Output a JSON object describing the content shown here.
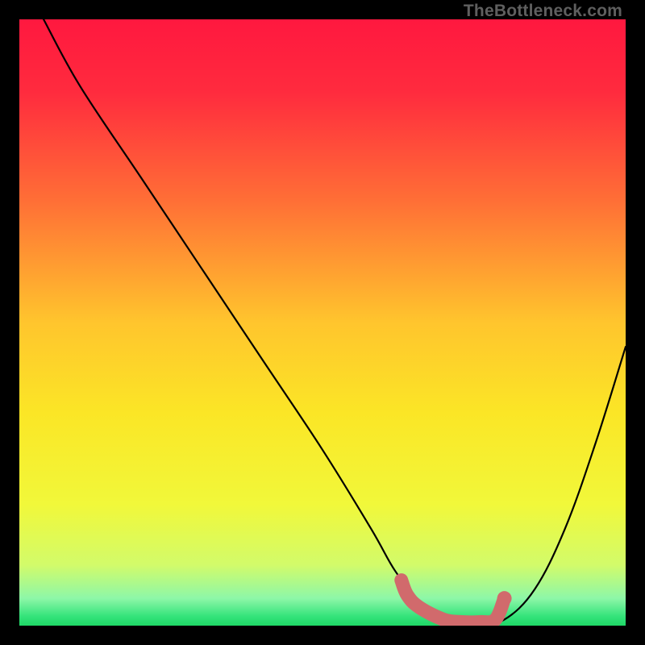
{
  "watermark": "TheBottleneck.com",
  "chart_data": {
    "type": "line",
    "title": "",
    "xlabel": "",
    "ylabel": "",
    "xlim": [
      0,
      100
    ],
    "ylim": [
      0,
      100
    ],
    "gradient_stops": [
      {
        "pos": 0.0,
        "color": "#ff183f"
      },
      {
        "pos": 0.12,
        "color": "#ff2b3e"
      },
      {
        "pos": 0.3,
        "color": "#ff6f36"
      },
      {
        "pos": 0.5,
        "color": "#ffc52d"
      },
      {
        "pos": 0.65,
        "color": "#fbe626"
      },
      {
        "pos": 0.8,
        "color": "#f1f83a"
      },
      {
        "pos": 0.9,
        "color": "#d2fb6a"
      },
      {
        "pos": 0.955,
        "color": "#8df7a8"
      },
      {
        "pos": 0.985,
        "color": "#33e37a"
      },
      {
        "pos": 1.0,
        "color": "#1fd866"
      }
    ],
    "series": [
      {
        "name": "bottleneck-curve",
        "x": [
          4,
          10,
          20,
          30,
          40,
          50,
          58,
          62,
          66,
          70,
          73,
          76,
          80,
          85,
          90,
          95,
          100
        ],
        "y": [
          100,
          89,
          74,
          59,
          44,
          29,
          16,
          9,
          4,
          1,
          0.5,
          0.5,
          1,
          6,
          16,
          30,
          46
        ]
      }
    ],
    "highlight_segment": {
      "name": "sweet-spot",
      "color": "#d16a6c",
      "points": [
        {
          "x": 63,
          "y": 7.5
        },
        {
          "x": 64,
          "y": 5.0
        },
        {
          "x": 66,
          "y": 3.0
        },
        {
          "x": 70,
          "y": 1.0
        },
        {
          "x": 73,
          "y": 0.6
        },
        {
          "x": 76,
          "y": 0.6
        },
        {
          "x": 78.5,
          "y": 1.0
        },
        {
          "x": 80,
          "y": 4.5
        }
      ],
      "endpoint": {
        "x": 80,
        "y": 4.5
      }
    }
  }
}
